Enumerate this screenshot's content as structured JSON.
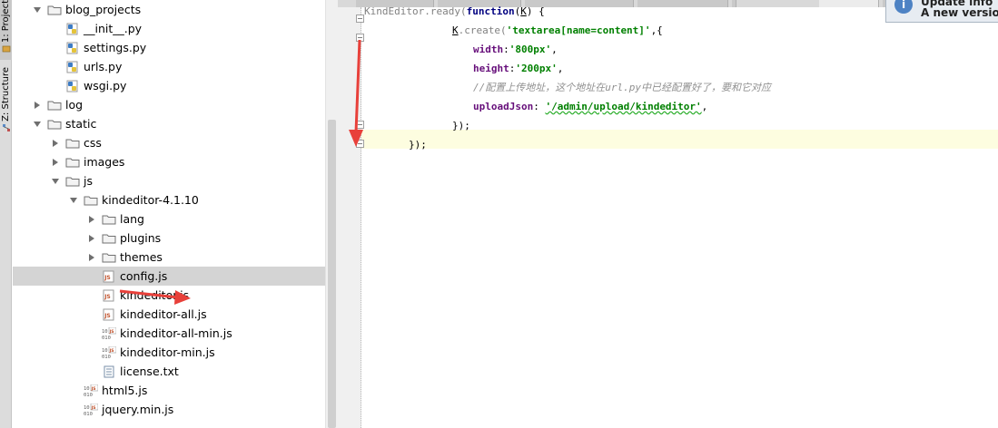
{
  "toolwindows": {
    "project_tab": "1: Project",
    "structure_tab": "Z: Structure"
  },
  "tree": {
    "items": [
      {
        "label": "blog_projects",
        "type": "folder",
        "expanded": true
      },
      {
        "label": "__init__.py",
        "type": "python"
      },
      {
        "label": "settings.py",
        "type": "python"
      },
      {
        "label": "urls.py",
        "type": "python"
      },
      {
        "label": "wsgi.py",
        "type": "python"
      },
      {
        "label": "log",
        "type": "folder",
        "expanded": false
      },
      {
        "label": "static",
        "type": "folder",
        "expanded": true
      },
      {
        "label": "css",
        "type": "folder",
        "expanded": false
      },
      {
        "label": "images",
        "type": "folder",
        "expanded": false
      },
      {
        "label": "js",
        "type": "folder",
        "expanded": true
      },
      {
        "label": "kindeditor-4.1.10",
        "type": "folder",
        "expanded": true
      },
      {
        "label": "lang",
        "type": "folder",
        "expanded": false
      },
      {
        "label": "plugins",
        "type": "folder",
        "expanded": false
      },
      {
        "label": "themes",
        "type": "folder",
        "expanded": false
      },
      {
        "label": "config.js",
        "type": "js",
        "selected": true
      },
      {
        "label": "kindeditor.js",
        "type": "js"
      },
      {
        "label": "kindeditor-all.js",
        "type": "js"
      },
      {
        "label": "kindeditor-all-min.js",
        "type": "jsmin"
      },
      {
        "label": "kindeditor-min.js",
        "type": "jsmin"
      },
      {
        "label": "license.txt",
        "type": "text"
      },
      {
        "label": "html5.js",
        "type": "jsmin"
      },
      {
        "label": "jquery.min.js",
        "type": "jsmin"
      }
    ]
  },
  "editor": {
    "lines": [
      {
        "tokens": [
          {
            "t": "KindEditor.ready(",
            "c": "gray"
          },
          {
            "t": "function",
            "c": "kw"
          },
          {
            "t": "(",
            "c": "plain"
          },
          {
            "t": "K",
            "c": "plain",
            "ul": true
          },
          {
            "t": ") {",
            "c": "plain"
          }
        ]
      },
      {
        "tokens": [
          {
            "t": "K",
            "c": "plain",
            "ul": true
          },
          {
            "t": ".create(",
            "c": "gray"
          },
          {
            "t": "'textarea[name=content]'",
            "c": "str"
          },
          {
            "t": ",{",
            "c": "plain"
          }
        ]
      },
      {
        "tokens": [
          {
            "t": "width",
            "c": "prop"
          },
          {
            "t": ":",
            "c": "plain"
          },
          {
            "t": "'800px'",
            "c": "str"
          },
          {
            "t": ",",
            "c": "plain"
          }
        ]
      },
      {
        "tokens": [
          {
            "t": "height",
            "c": "prop"
          },
          {
            "t": ":",
            "c": "plain"
          },
          {
            "t": "'200px'",
            "c": "str"
          },
          {
            "t": ",",
            "c": "plain"
          }
        ]
      },
      {
        "tokens": [
          {
            "t": "//配置上传地址，这个地址在url.py中已经配置好了，要和它对应",
            "c": "comment"
          }
        ]
      },
      {
        "tokens": [
          {
            "t": "uploadJson",
            "c": "prop"
          },
          {
            "t": ": ",
            "c": "plain"
          },
          {
            "t": "'/admin/upload/kindeditor'",
            "c": "str",
            "ul": true
          },
          {
            "t": ",",
            "c": "plain"
          }
        ]
      },
      {
        "tokens": [
          {
            "t": "});",
            "c": "plain"
          }
        ]
      },
      {
        "tokens": [
          {
            "t": "});",
            "c": "plain"
          }
        ]
      }
    ]
  },
  "notification": {
    "title": "Update info",
    "body": "A new version",
    "icon": "info-icon"
  },
  "colors": {
    "annotation": "#e8403a",
    "current_line": "#fdfde0",
    "selection": "#d4d4d4"
  }
}
